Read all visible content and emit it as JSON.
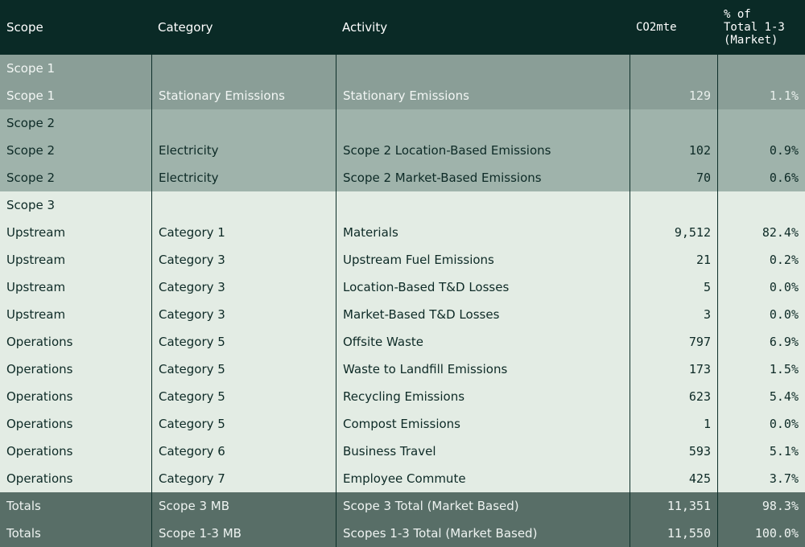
{
  "header": {
    "scope": "Scope",
    "category": "Category",
    "activity": "Activity",
    "co2": "CO2mte",
    "pct": "% of\nTotal 1-3\n(Market)"
  },
  "rows": [
    {
      "group": "s1",
      "scope": "Scope 1",
      "category": "",
      "activity": "",
      "co2": "",
      "pct": ""
    },
    {
      "group": "s1",
      "scope": "Scope 1",
      "category": "Stationary Emissions",
      "activity": "Stationary Emissions",
      "co2": "129",
      "pct": "1.1%"
    },
    {
      "group": "s2",
      "scope": "Scope 2",
      "category": "",
      "activity": "",
      "co2": "",
      "pct": ""
    },
    {
      "group": "s2",
      "scope": "Scope 2",
      "category": "Electricity",
      "activity": "Scope 2 Location-Based Emissions",
      "co2": "102",
      "pct": "0.9%"
    },
    {
      "group": "s2",
      "scope": "Scope 2",
      "category": "Electricity",
      "activity": "Scope 2 Market-Based Emissions",
      "co2": "70",
      "pct": "0.6%"
    },
    {
      "group": "s3",
      "scope": "Scope 3",
      "category": "",
      "activity": "",
      "co2": "",
      "pct": ""
    },
    {
      "group": "s3",
      "scope": "Upstream",
      "category": "Category 1",
      "activity": "Materials",
      "co2": "9,512",
      "pct": "82.4%"
    },
    {
      "group": "s3",
      "scope": "Upstream",
      "category": "Category 3",
      "activity": "Upstream Fuel Emissions",
      "co2": "21",
      "pct": "0.2%"
    },
    {
      "group": "s3",
      "scope": "Upstream",
      "category": "Category 3",
      "activity": "Location-Based T&D Losses",
      "co2": "5",
      "pct": "0.0%"
    },
    {
      "group": "s3",
      "scope": "Upstream",
      "category": "Category 3",
      "activity": "Market-Based T&D Losses",
      "co2": "3",
      "pct": "0.0%"
    },
    {
      "group": "s3",
      "scope": "Operations",
      "category": "Category 5",
      "activity": "Offsite Waste",
      "co2": "797",
      "pct": "6.9%"
    },
    {
      "group": "s3",
      "scope": "Operations",
      "category": "Category 5",
      "activity": "Waste to Landfill Emissions",
      "co2": "173",
      "pct": "1.5%"
    },
    {
      "group": "s3",
      "scope": "Operations",
      "category": "Category 5",
      "activity": "Recycling Emissions",
      "co2": "623",
      "pct": "5.4%"
    },
    {
      "group": "s3",
      "scope": "Operations",
      "category": "Category 5",
      "activity": "Compost Emissions",
      "co2": "1",
      "pct": "0.0%"
    },
    {
      "group": "s3",
      "scope": "Operations",
      "category": "Category 6",
      "activity": "Business Travel",
      "co2": "593",
      "pct": "5.1%"
    },
    {
      "group": "s3",
      "scope": "Operations",
      "category": "Category 7",
      "activity": "Employee Commute",
      "co2": "425",
      "pct": "3.7%"
    },
    {
      "group": "tot",
      "scope": "Totals",
      "category": "Scope 3 MB",
      "activity": "Scope 3 Total (Market Based)",
      "co2": "11,351",
      "pct": "98.3%"
    },
    {
      "group": "tot",
      "scope": "Totals",
      "category": "Scope 1-3 MB",
      "activity": "Scopes 1-3 Total (Market Based)",
      "co2": "11,550",
      "pct": "100.0%"
    }
  ],
  "colors": {
    "header_bg": "#0a2a26",
    "scope1_bg": "#8a9e97",
    "scope2_bg": "#9fb3ab",
    "scope3_bg": "#e3ece4",
    "totals_bg": "#586e67"
  }
}
